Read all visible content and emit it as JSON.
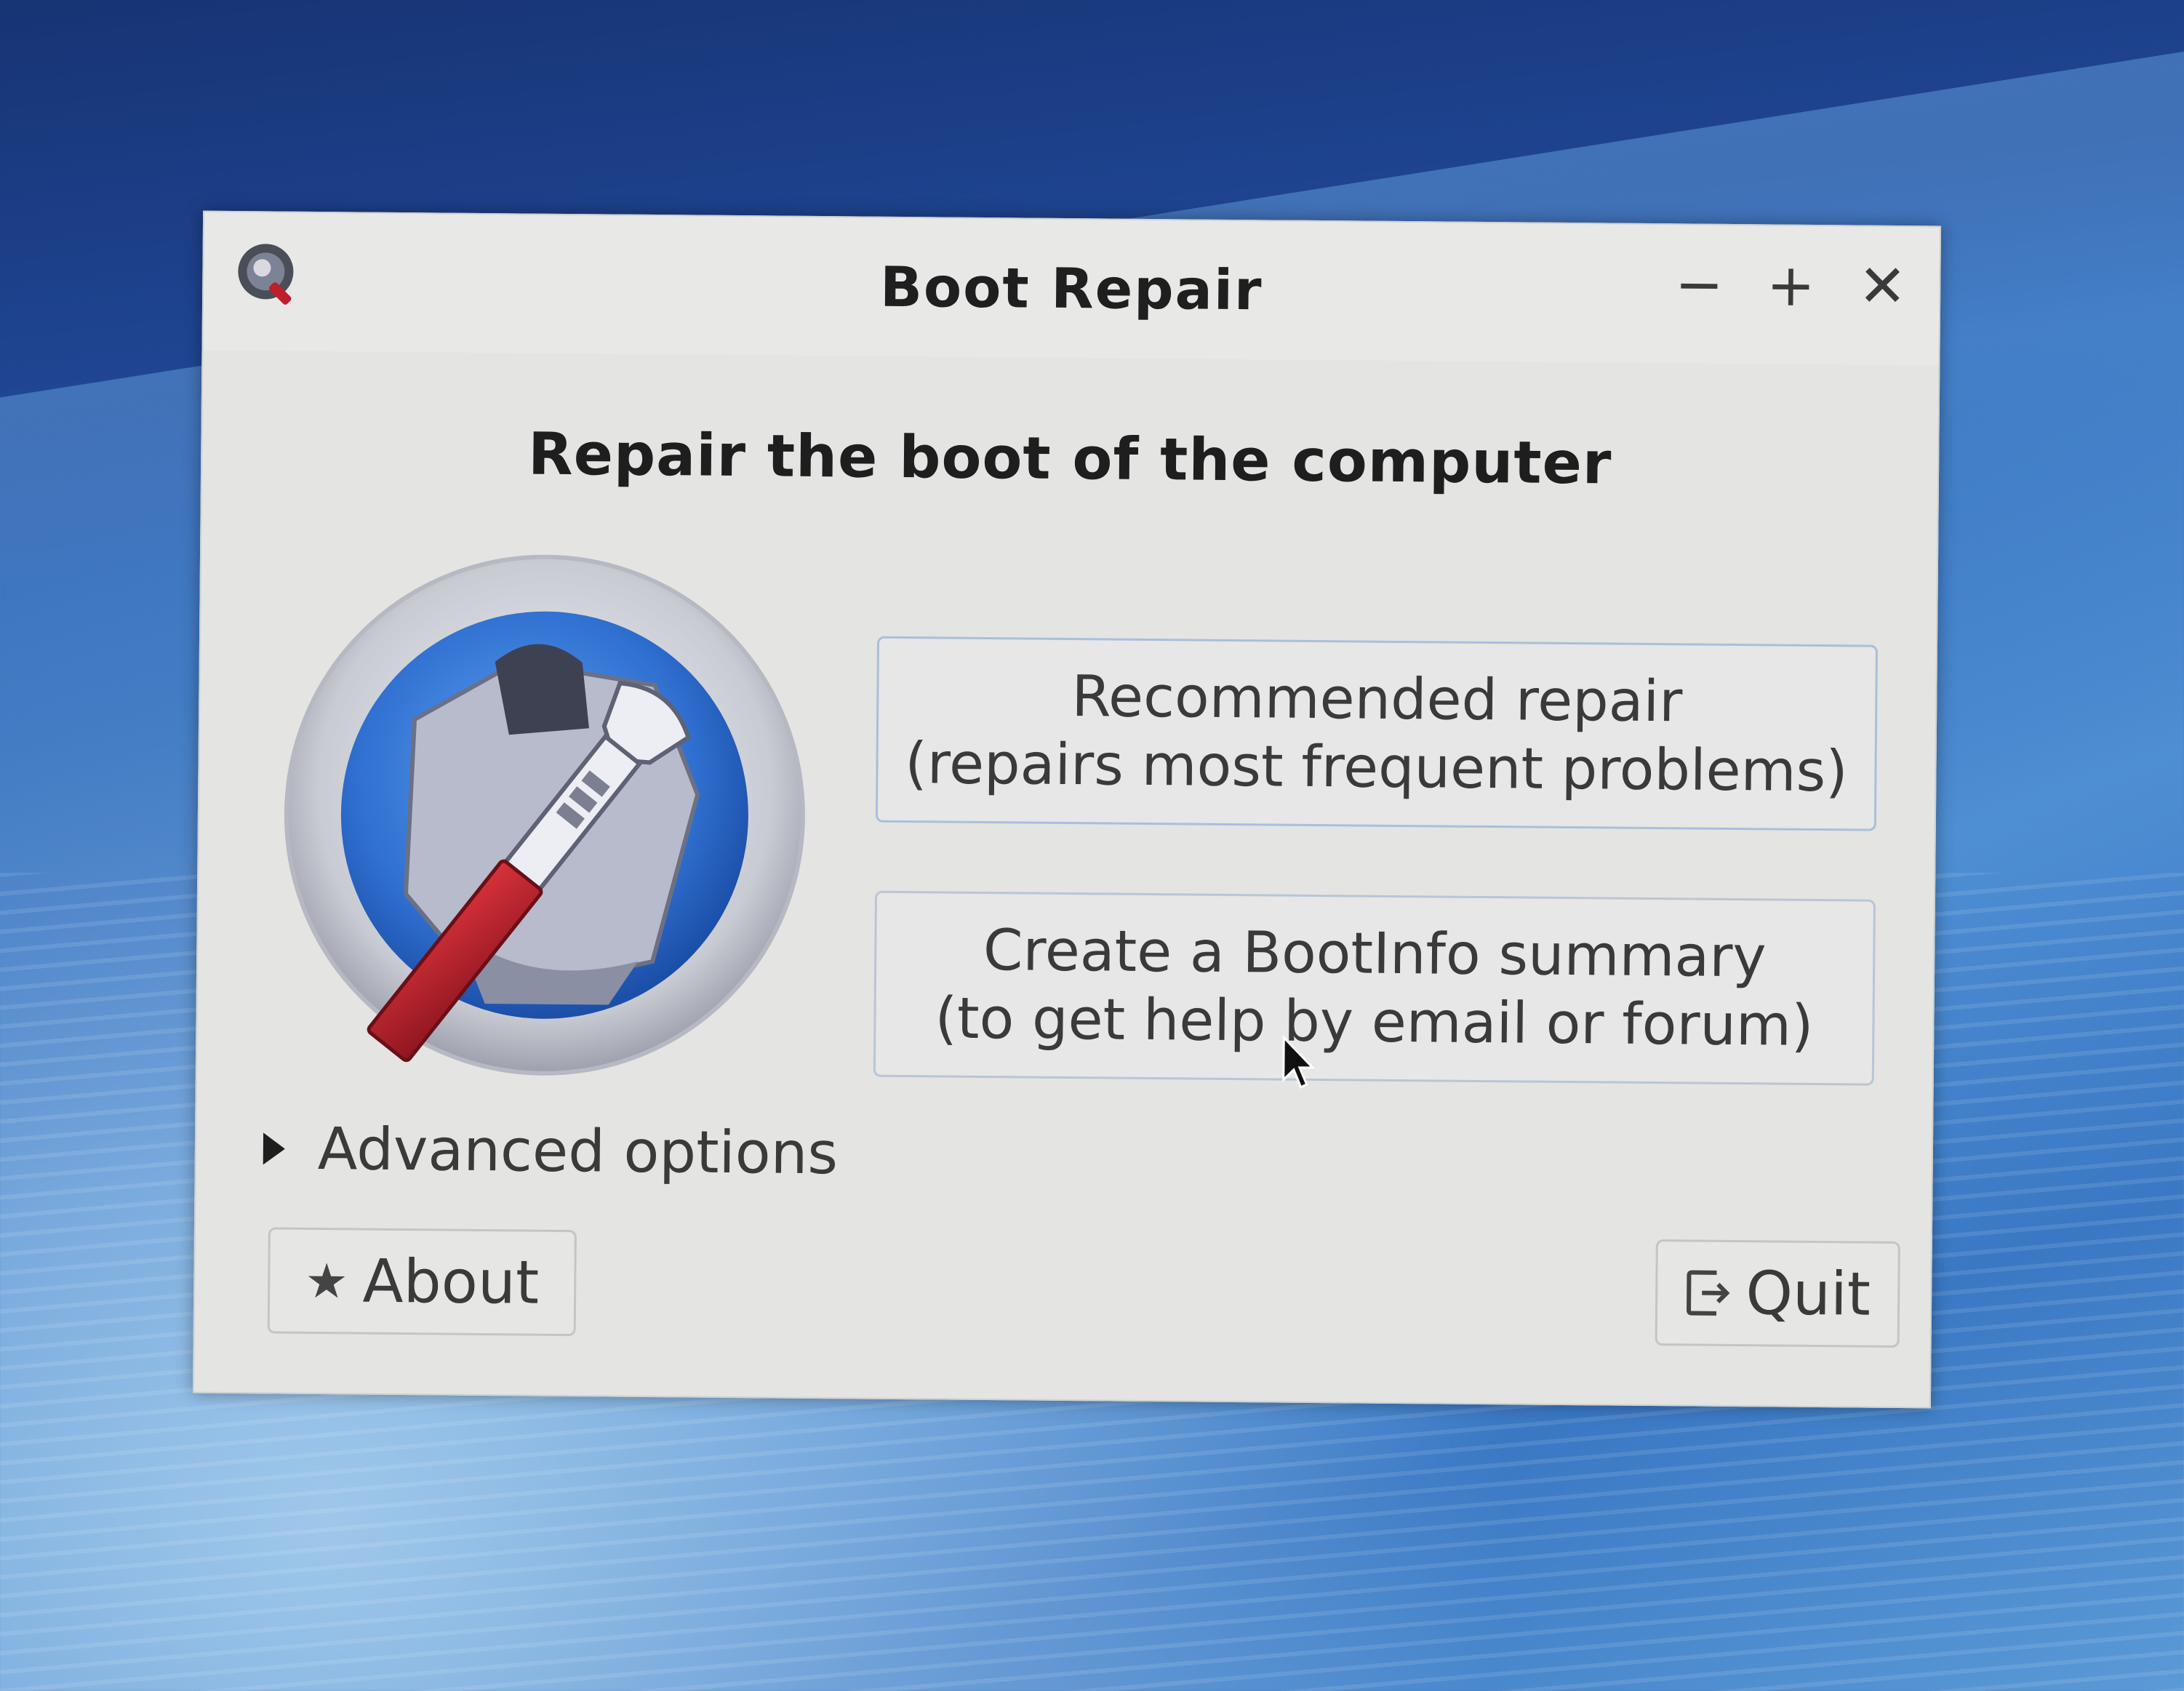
{
  "window": {
    "title": "Boot Repair",
    "controls": {
      "minimize": "−",
      "maximize": "+",
      "close": "✕"
    }
  },
  "main": {
    "heading": "Repair the boot of the computer",
    "recommended_button": {
      "line1": "Recommended repair",
      "line2": "(repairs most frequent problems)"
    },
    "bootinfo_button": {
      "line1": "Create a BootInfo summary",
      "line2": "(to get help by email or forum)"
    },
    "advanced_options_label": "Advanced options"
  },
  "footer": {
    "about_label": "About",
    "quit_label": "Quit"
  },
  "icons": {
    "app": "boot-repair-icon",
    "logo": "wrench-logo-icon",
    "about": "star-icon",
    "quit": "exit-icon",
    "expander": "triangle-right-icon",
    "cursor": "mouse-pointer-icon"
  },
  "colors": {
    "window_bg": "#e4e4e2",
    "logo_blue": "#2f6fd0",
    "wrench_handle": "#b8202a",
    "button_border_focus": "#a9bfdb"
  }
}
